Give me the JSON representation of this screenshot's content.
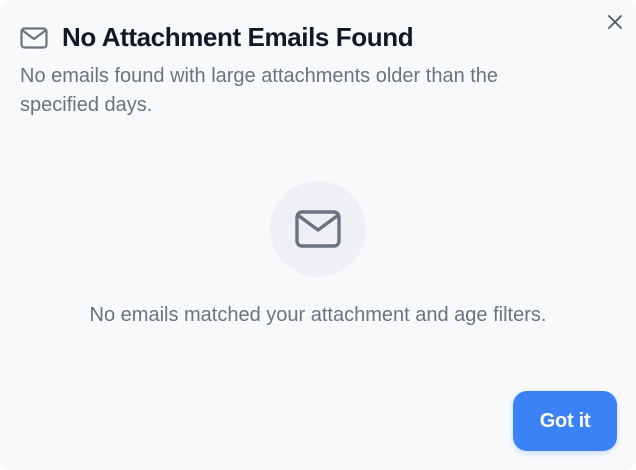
{
  "dialog": {
    "title": "No Attachment Emails Found",
    "subtitle": "No emails found with large attachments older than the specified days.",
    "header_icon": "mail-icon",
    "close_icon": "close-icon",
    "close_label": "Close"
  },
  "empty_state": {
    "icon": "mail-icon",
    "message": "No emails matched your attachment and age filters."
  },
  "actions": {
    "confirm_label": "Got it"
  },
  "colors": {
    "primary": "#3b82f6",
    "title_text": "#111827",
    "muted_text": "#6b7280",
    "icon_gray": "#6b7280",
    "background": "#f8f9fb",
    "icon_circle_bg": "#eef0f3"
  }
}
